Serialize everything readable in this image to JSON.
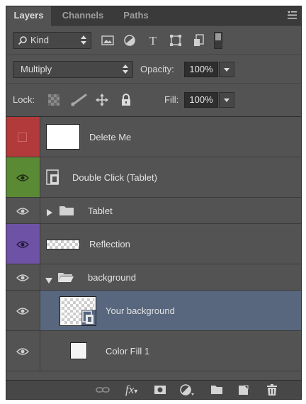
{
  "panel": {
    "tabs": [
      {
        "label": "Layers",
        "active": true
      },
      {
        "label": "Channels",
        "active": false
      },
      {
        "label": "Paths",
        "active": false
      }
    ]
  },
  "filter": {
    "kind_label": "Kind",
    "icons": [
      "image-filter-icon",
      "adjustment-filter-icon",
      "type-filter-icon",
      "shape-filter-icon",
      "smart-object-filter-icon",
      "filter-toggle-switch"
    ]
  },
  "blend": {
    "mode": "Multiply",
    "opacity_label": "Opacity:",
    "opacity_value": "100%"
  },
  "lock": {
    "label": "Lock:",
    "icons": [
      "lock-transparency-icon",
      "lock-pixels-icon",
      "lock-position-icon",
      "lock-all-icon"
    ],
    "fill_label": "Fill:",
    "fill_value": "100%"
  },
  "layers": [
    {
      "name": "Delete Me",
      "visible": false,
      "color_label": "red",
      "kind": "pixel-white"
    },
    {
      "name": "Double Click (Tablet)",
      "visible": true,
      "color_label": "green",
      "kind": "smart-object"
    },
    {
      "name": "Tablet",
      "visible": true,
      "color_label": "none",
      "kind": "group",
      "expanded": false
    },
    {
      "name": "Reflection",
      "visible": true,
      "color_label": "purple",
      "kind": "pixel-transparent"
    },
    {
      "name": "background",
      "visible": true,
      "color_label": "none",
      "kind": "group",
      "expanded": true
    },
    {
      "name": "Your background",
      "visible": true,
      "color_label": "none",
      "kind": "smart-object-transparent",
      "selected": true
    },
    {
      "name": "Color Fill 1",
      "visible": true,
      "color_label": "none",
      "kind": "fill-white"
    }
  ],
  "colors": {
    "panel_bg": "#535353",
    "selected_row": "#58677e",
    "label_red": "#b23a3a",
    "label_green": "#5a8a34",
    "label_purple": "#6e52a6"
  },
  "bottom_toolbar": {
    "icons": [
      "link-layers-icon",
      "layer-style-fx-icon",
      "add-mask-icon",
      "adjustment-layer-icon",
      "new-group-icon",
      "new-layer-icon",
      "delete-layer-icon"
    ],
    "fx_label": "fx"
  }
}
